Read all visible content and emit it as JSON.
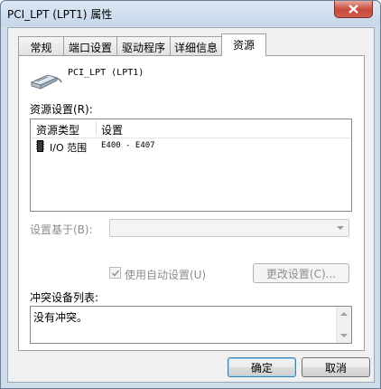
{
  "window": {
    "title": "PCI_LPT (LPT1) 属性"
  },
  "tabs": [
    {
      "label": "常规",
      "active": false
    },
    {
      "label": "端口设置",
      "active": false
    },
    {
      "label": "驱动程序",
      "active": false
    },
    {
      "label": "详细信息",
      "active": false
    },
    {
      "label": "资源",
      "active": true
    }
  ],
  "device": {
    "name": "PCI_LPT (LPT1)",
    "icon": "parallel-port-cable-icon"
  },
  "resource_settings": {
    "label": "资源设置(R):",
    "columns": [
      "资源类型",
      "设置"
    ],
    "rows": [
      {
        "type": "I/O 范围",
        "setting": "E400 - E407",
        "icon": "io-chip-icon"
      }
    ]
  },
  "setting_based_on": {
    "label": "设置基于(B):",
    "value": ""
  },
  "auto_settings": {
    "label": "使用自动设置(U)",
    "checked": true
  },
  "change_settings_button": "更改设置(C)...",
  "conflict": {
    "label": "冲突设备列表:",
    "text": "没有冲突。"
  },
  "buttons": {
    "ok": "确定",
    "cancel": "取消"
  },
  "colors": {
    "accent": "#3c7fb1",
    "close": "#c7483a"
  }
}
